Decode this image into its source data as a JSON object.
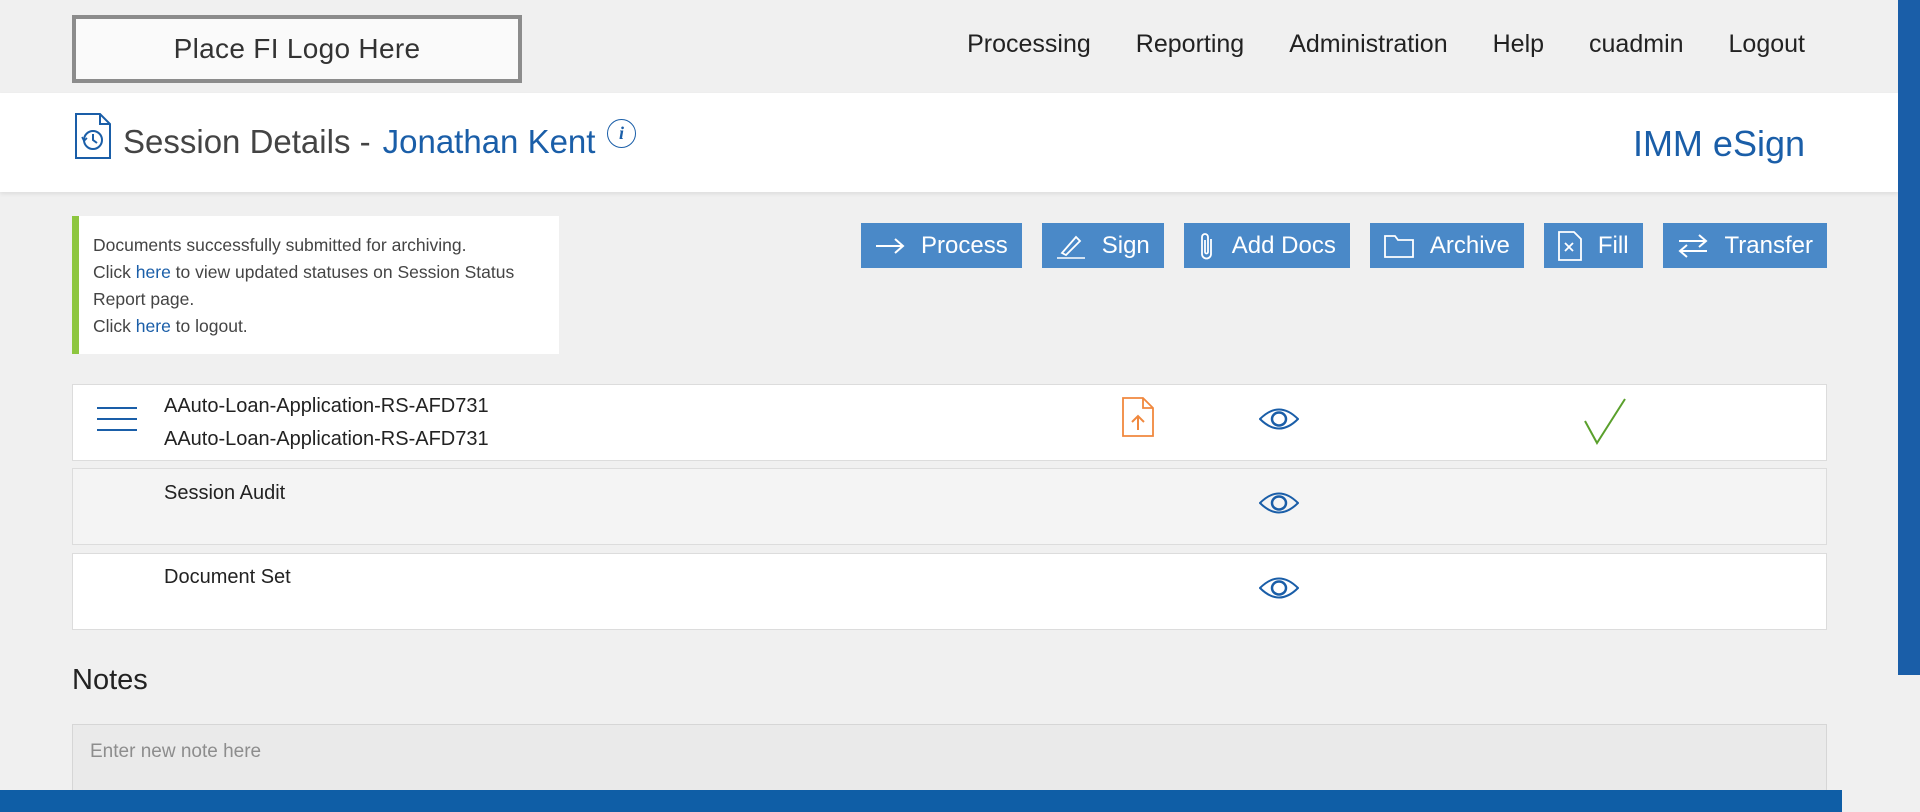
{
  "header": {
    "logo_text": "Place FI Logo Here",
    "nav": [
      "Processing",
      "Reporting",
      "Administration",
      "Help",
      "cuadmin",
      "Logout"
    ]
  },
  "titlebar": {
    "title_prefix": "Session Details -",
    "customer_name": "Jonathan Kent",
    "info_symbol": "i",
    "brand": "IMM eSign"
  },
  "message": {
    "line1": "Documents successfully submitted for archiving.",
    "line2_pre": "Click ",
    "line2_link": "here",
    "line2_post": " to view updated statuses on Session Status Report page.",
    "line3_pre": "Click ",
    "line3_link": "here",
    "line3_post": " to logout.",
    "accent_color": "#8dc63f"
  },
  "actions": {
    "process": "Process",
    "sign": "Sign",
    "add_docs": "Add Docs",
    "archive": "Archive",
    "fill": "Fill",
    "transfer": "Transfer",
    "button_color": "#4a89c8"
  },
  "documents": [
    {
      "name": "AAuto-Loan-Application-RS-AFD731",
      "subname": "AAuto-Loan-Application-RS-AFD731",
      "icons": [
        "menu-icon",
        "file-upload-icon",
        "eye-icon",
        "checkmark-icon"
      ]
    },
    {
      "name": "Session Audit",
      "icons": [
        "eye-icon"
      ]
    },
    {
      "name": "Document Set",
      "icons": [
        "eye-icon"
      ]
    }
  ],
  "notes": {
    "title": "Notes",
    "placeholder": "Enter new note here"
  },
  "colors": {
    "brand_blue": "#1a5ea8",
    "upload_orange": "#f0883e",
    "check_green": "#5aa02c"
  }
}
